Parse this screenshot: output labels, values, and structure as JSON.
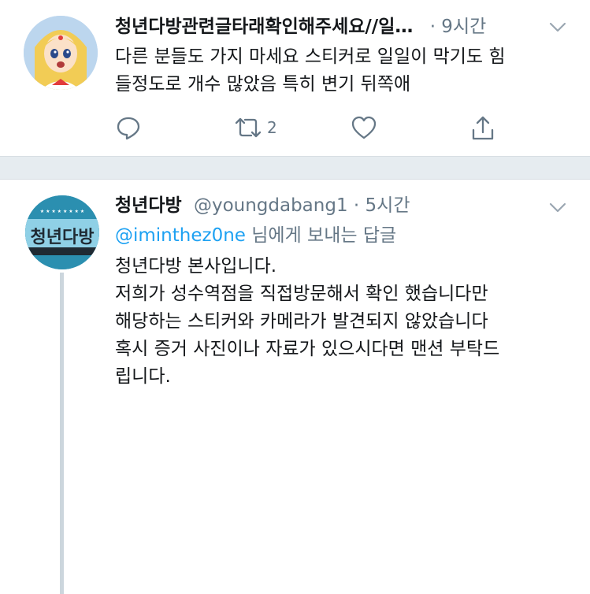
{
  "tweet1": {
    "name": "청년다방관련글타래확인해주세요//일…",
    "time": "· 9시간",
    "text": "다른 분들도 가지 마세요 스티커로 일일이 막기도 힘\n들정도로 개수 많았음 특히 변기 뒤쪽애",
    "retweet_count": "2"
  },
  "tweet2": {
    "name": "청년다방",
    "handle": "@youngdabang1",
    "time": "· 5시간",
    "reply_mention": "@iminthez0ne",
    "reply_suffix": " 님에게 보내는 답글",
    "avatar_text": "청년다방",
    "text": "청년다방 본사입니다.\n저희가 성수역점을 직접방문해서 확인 했습니다만\n해당하는 스티커와 카메라가 발견되지 않았습니다\n혹시 증거 사진이나 자료가 있으시다면 맨션 부탁드\n립니다."
  },
  "colors": {
    "accent": "#1da1f2",
    "meta": "#657786",
    "separator": "#e6ecf0"
  }
}
